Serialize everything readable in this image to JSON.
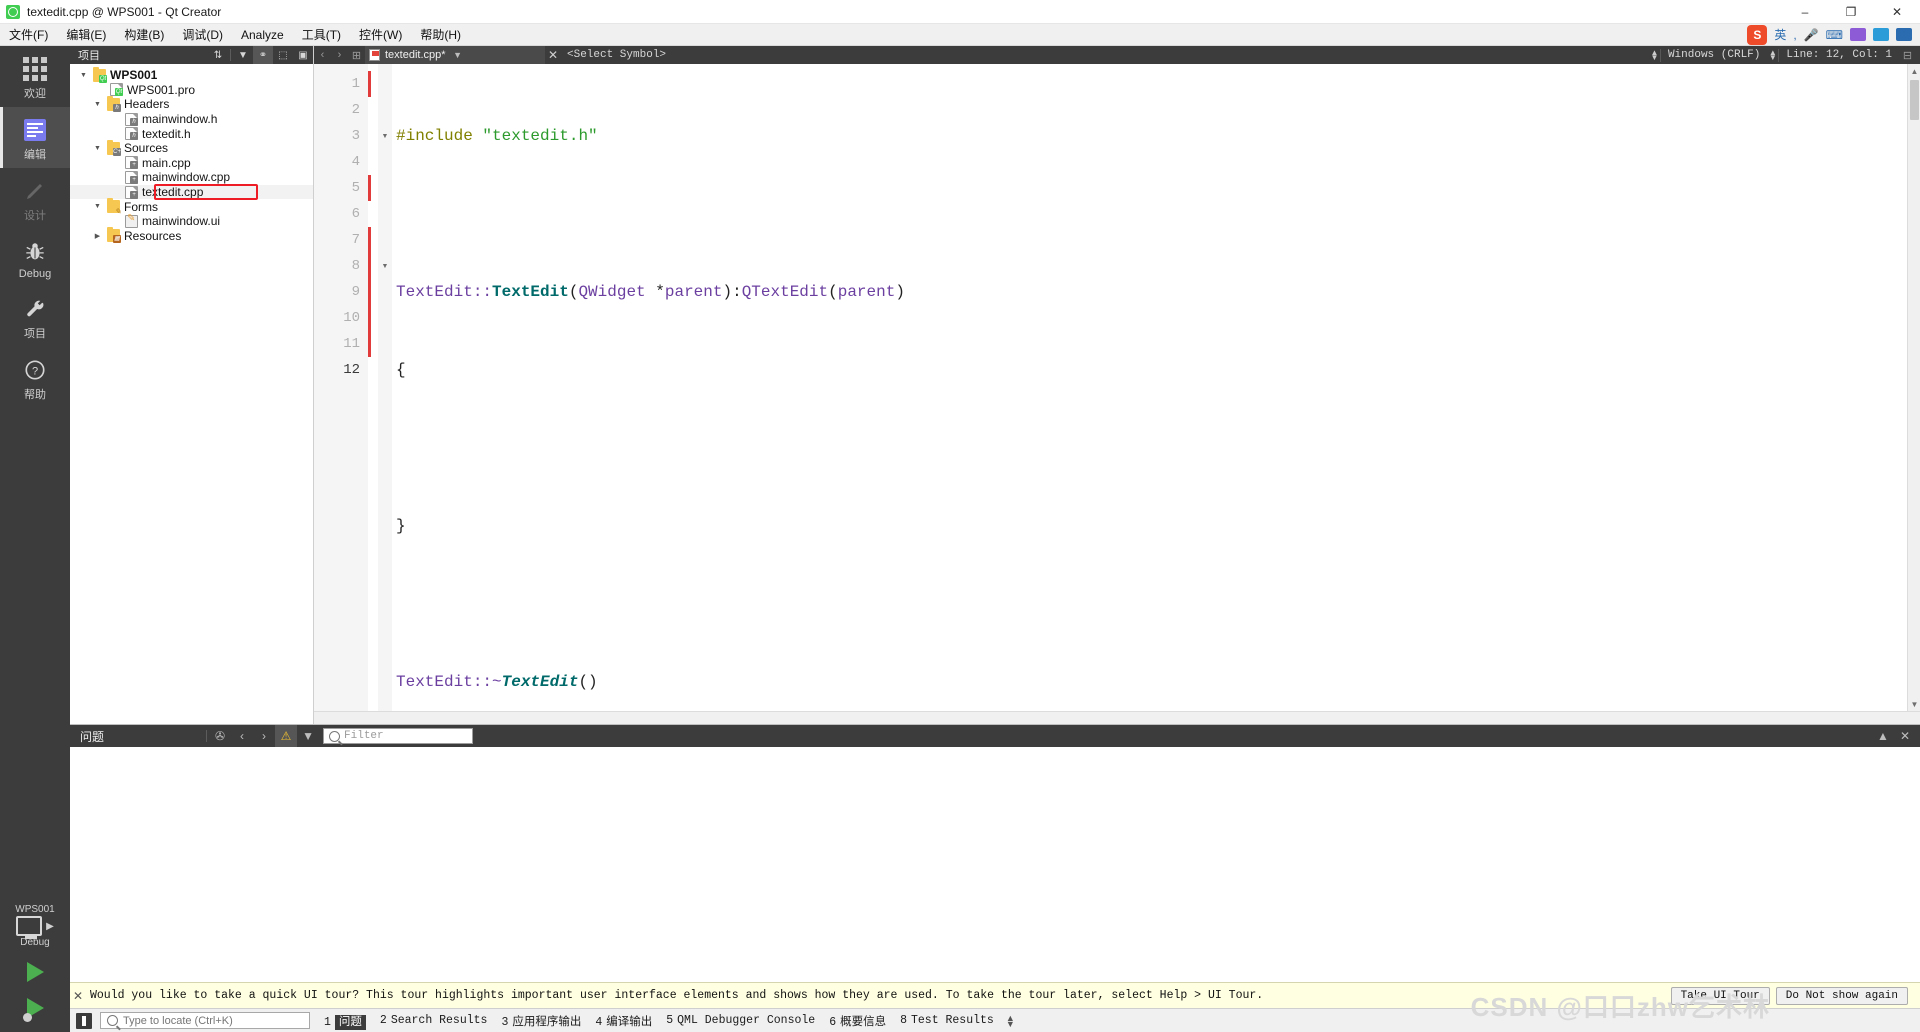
{
  "window": {
    "title": "textedit.cpp @ WPS001 - Qt Creator",
    "minimize": "–",
    "maximize": "❐",
    "close": "✕"
  },
  "menubar": {
    "items": [
      {
        "label": "文件(F)",
        "name": "menu-file"
      },
      {
        "label": "编辑(E)",
        "name": "menu-edit"
      },
      {
        "label": "构建(B)",
        "name": "menu-build"
      },
      {
        "label": "调试(D)",
        "name": "menu-debug"
      },
      {
        "label": "Analyze",
        "name": "menu-analyze"
      },
      {
        "label": "工具(T)",
        "name": "menu-tools"
      },
      {
        "label": "控件(W)",
        "name": "menu-window"
      },
      {
        "label": "帮助(H)",
        "name": "menu-help"
      }
    ],
    "tray": {
      "wps": "S",
      "ime": "英"
    }
  },
  "modebar": {
    "modes": [
      {
        "label": "欢迎",
        "icon": "grid-icon",
        "active": false,
        "disabled": false
      },
      {
        "label": "编辑",
        "icon": "document-lines-icon",
        "active": true,
        "disabled": false
      },
      {
        "label": "设计",
        "icon": "pencil-icon",
        "active": false,
        "disabled": true
      },
      {
        "label": "Debug",
        "icon": "bug-icon",
        "active": false,
        "disabled": false
      },
      {
        "label": "项目",
        "icon": "wrench-icon",
        "active": false,
        "disabled": false
      },
      {
        "label": "帮助",
        "icon": "question-circle-icon",
        "active": false,
        "disabled": false
      }
    ],
    "kit": {
      "project": "WPS001",
      "build_config": "Debug"
    }
  },
  "project_panel": {
    "title": "项目",
    "toolbar": [
      {
        "name": "sync-sort-icon",
        "glyph": "⇅"
      },
      {
        "name": "filter-icon",
        "glyph": "▼"
      },
      {
        "name": "link-with-editor-icon",
        "glyph": "⚭",
        "active": true
      },
      {
        "name": "split-icon",
        "glyph": "⬚"
      },
      {
        "name": "close-split-icon",
        "glyph": "▣"
      }
    ],
    "tree": [
      {
        "label": "WPS001",
        "indent": 0,
        "icon": "qt-project-folder-icon",
        "expanded": true,
        "bold": true
      },
      {
        "label": "WPS001.pro",
        "indent": 1,
        "icon": "qt-pro-file-icon",
        "expanded": null,
        "bold": false
      },
      {
        "label": "Headers",
        "indent": 1,
        "icon": "headers-folder-icon",
        "expanded": true,
        "bold": false
      },
      {
        "label": "mainwindow.h",
        "indent": 2,
        "icon": "header-file-icon",
        "expanded": null,
        "bold": false
      },
      {
        "label": "textedit.h",
        "indent": 2,
        "icon": "header-file-icon",
        "expanded": null,
        "bold": false
      },
      {
        "label": "Sources",
        "indent": 1,
        "icon": "sources-folder-icon",
        "expanded": true,
        "bold": false
      },
      {
        "label": "main.cpp",
        "indent": 2,
        "icon": "cpp-file-icon",
        "expanded": null,
        "bold": false
      },
      {
        "label": "mainwindow.cpp",
        "indent": 2,
        "icon": "cpp-file-icon",
        "expanded": null,
        "bold": false
      },
      {
        "label": "textedit.cpp",
        "indent": 2,
        "icon": "cpp-file-icon",
        "expanded": null,
        "bold": false,
        "highlighted": true,
        "selected": true
      },
      {
        "label": "Forms",
        "indent": 1,
        "icon": "forms-folder-icon",
        "expanded": true,
        "bold": false
      },
      {
        "label": "mainwindow.ui",
        "indent": 2,
        "icon": "ui-file-icon",
        "expanded": null,
        "bold": false
      },
      {
        "label": "Resources",
        "indent": 1,
        "icon": "resources-folder-icon",
        "expanded": false,
        "bold": false
      }
    ],
    "highlight_color": "#ee1c24"
  },
  "editor": {
    "tab": {
      "name": "textedit.cpp*",
      "close": "✕"
    },
    "symbol_selector": "<Select Symbol>",
    "line_ending": "Windows (CRLF)",
    "cursor_position": "Line: 12, Col: 1",
    "nav_back": "‹",
    "nav_forward": "›",
    "split_icon": "⊞",
    "lines": [
      {
        "n": "1",
        "tokens": [
          {
            "t": "#include ",
            "c": "pp"
          },
          {
            "t": "\"textedit.h\"",
            "c": "str"
          }
        ]
      },
      {
        "n": "2",
        "tokens": []
      },
      {
        "n": "3",
        "fold": true,
        "changed": true,
        "tokens": [
          {
            "t": "TextEdit",
            "c": "cls"
          },
          {
            "t": "::",
            "c": "cls"
          },
          {
            "t": "TextEdit",
            "c": "fn"
          },
          {
            "t": "(",
            "c": "pl"
          },
          {
            "t": "QWidget",
            "c": "typ"
          },
          {
            "t": " *",
            "c": "pl"
          },
          {
            "t": "parent",
            "c": "var"
          },
          {
            "t": ")",
            "c": "pl"
          },
          {
            "t": ":",
            "c": "pl"
          },
          {
            "t": "QTextEdit",
            "c": "typ"
          },
          {
            "t": "(",
            "c": "pl"
          },
          {
            "t": "parent",
            "c": "var"
          },
          {
            "t": ")",
            "c": "pl"
          }
        ]
      },
      {
        "n": "4",
        "tokens": [
          {
            "t": "{",
            "c": "pl"
          }
        ]
      },
      {
        "n": "5",
        "changed": true,
        "tokens": []
      },
      {
        "n": "6",
        "tokens": [
          {
            "t": "}",
            "c": "pl"
          }
        ]
      },
      {
        "n": "7",
        "changed": true,
        "tokens": []
      },
      {
        "n": "8",
        "fold": true,
        "changed": true,
        "tokens": [
          {
            "t": "TextEdit",
            "c": "cls"
          },
          {
            "t": "::~",
            "c": "cls"
          },
          {
            "t": "TextEdit",
            "c": "fnI"
          },
          {
            "t": "()",
            "c": "pl"
          }
        ]
      },
      {
        "n": "9",
        "changed": true,
        "tokens": [
          {
            "t": "{",
            "c": "pl"
          }
        ]
      },
      {
        "n": "10",
        "changed": true,
        "tokens": []
      },
      {
        "n": "11",
        "changed": true,
        "tokens": [
          {
            "t": "}",
            "c": "pl"
          }
        ]
      },
      {
        "n": "12",
        "current": true,
        "caret": true,
        "tokens": []
      }
    ]
  },
  "issues_panel": {
    "title": "问题",
    "filter_placeholder": "Filter",
    "buttons": [
      {
        "name": "clear-icon",
        "glyph": "✇"
      },
      {
        "name": "prev-issue-icon",
        "glyph": "‹"
      },
      {
        "name": "next-issue-icon",
        "glyph": "›"
      },
      {
        "name": "warning-filter-icon",
        "glyph": "⚠",
        "active": true
      },
      {
        "name": "filter-dropdown-icon",
        "glyph": "▼"
      }
    ],
    "maximize": "▲",
    "close": "✕"
  },
  "tour_bar": {
    "message": "Would you like to take a quick UI tour? This tour highlights important user interface elements and shows how they are used. To take the tour later, select Help > UI Tour.",
    "take_tour": "Take UI Tour",
    "dismiss": "Do Not show again",
    "close": "✕"
  },
  "statusbar": {
    "locate_placeholder": "Type to locate (Ctrl+K)",
    "items": [
      {
        "num": "1",
        "label": "问题",
        "active": true
      },
      {
        "num": "2",
        "label": "Search Results",
        "active": false
      },
      {
        "num": "3",
        "label": "应用程序输出",
        "active": false
      },
      {
        "num": "4",
        "label": "编译输出",
        "active": false
      },
      {
        "num": "5",
        "label": "QML Debugger Console",
        "active": false
      },
      {
        "num": "6",
        "label": "概要信息",
        "active": false
      },
      {
        "num": "8",
        "label": "Test Results",
        "active": false
      }
    ]
  },
  "watermark": {
    "text": "CSDN @口口zhw乞术林"
  }
}
